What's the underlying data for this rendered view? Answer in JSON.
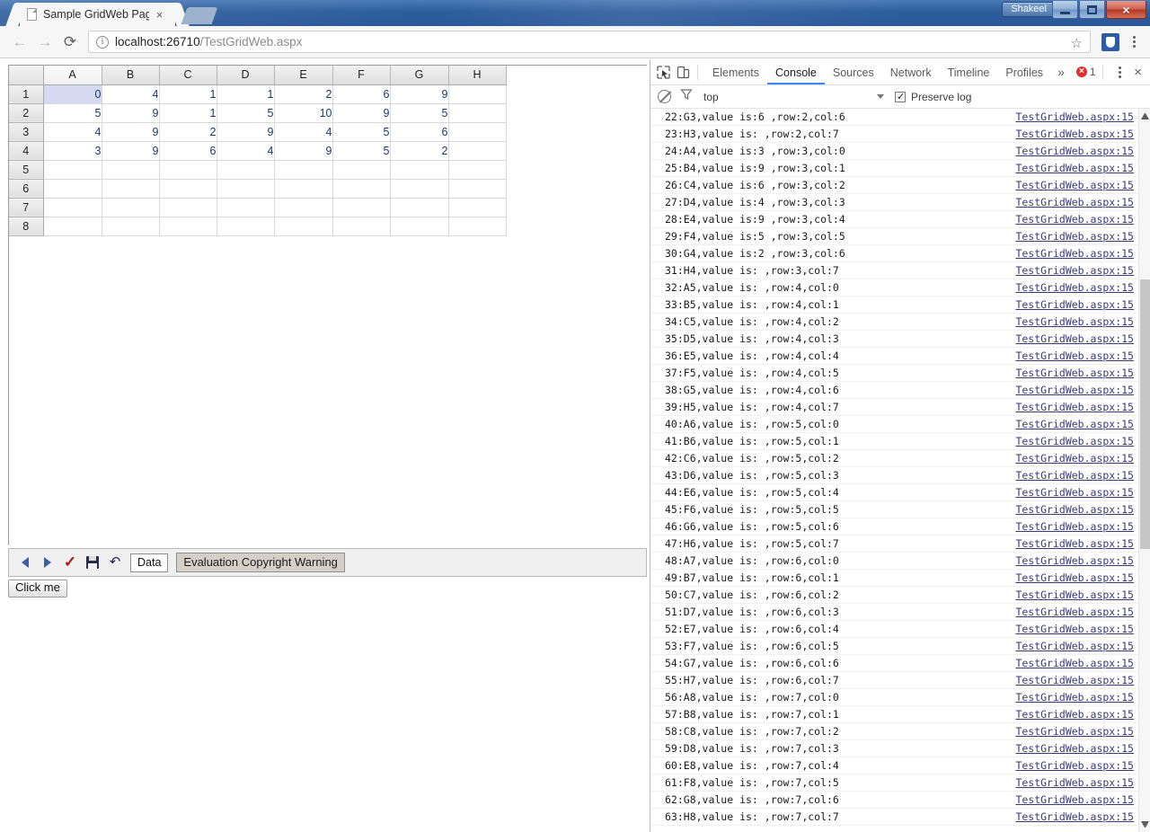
{
  "window": {
    "user_button_label": "Shakeel",
    "minimize_label": "–",
    "maximize_label": "",
    "close_label": "×"
  },
  "tabstrip": {
    "tab_title": "Sample GridWeb Page",
    "tab_close_label": "×",
    "new_tab_label": ""
  },
  "toolbar": {
    "back_label": "←",
    "forward_label": "→",
    "reload_label": "⟳",
    "info_label": "i",
    "url_host": "localhost:26710",
    "url_path": "/TestGridWeb.aspx",
    "star_label": "☆",
    "extension_name": "extension-icon",
    "menu_label": "menu"
  },
  "spreadsheet": {
    "columns": [
      "A",
      "B",
      "C",
      "D",
      "E",
      "F",
      "G",
      "H"
    ],
    "rows": [
      "1",
      "2",
      "3",
      "4",
      "5",
      "6",
      "7",
      "8"
    ],
    "selected_cell": "A1",
    "data": [
      [
        "0",
        "4",
        "1",
        "1",
        "2",
        "6",
        "9",
        ""
      ],
      [
        "5",
        "9",
        "1",
        "5",
        "10",
        "9",
        "5",
        ""
      ],
      [
        "4",
        "9",
        "2",
        "9",
        "4",
        "5",
        "6",
        ""
      ],
      [
        "3",
        "9",
        "6",
        "4",
        "9",
        "5",
        "2",
        ""
      ],
      [
        "",
        "",
        "",
        "",
        "",
        "",
        "",
        ""
      ],
      [
        "",
        "",
        "",
        "",
        "",
        "",
        "",
        ""
      ],
      [
        "",
        "",
        "",
        "",
        "",
        "",
        "",
        ""
      ],
      [
        "",
        "",
        "",
        "",
        "",
        "",
        "",
        ""
      ]
    ],
    "toolbar": {
      "prev_label": "",
      "next_label": "",
      "accept_label": "✓",
      "save_label": "save",
      "undo_label": "↶",
      "sheet_tab_label": "Data",
      "copyright_label": "Evaluation Copyright Warning"
    },
    "click_me_label": "Click me"
  },
  "devtools": {
    "inspect_icon": "inspect-element-icon",
    "device_icon": "device-toolbar-icon",
    "tabs": [
      {
        "label": "Elements",
        "active": false
      },
      {
        "label": "Console",
        "active": true
      },
      {
        "label": "Sources",
        "active": false
      },
      {
        "label": "Network",
        "active": false
      },
      {
        "label": "Timeline",
        "active": false
      },
      {
        "label": "Profiles",
        "active": false
      }
    ],
    "more_label": "»",
    "error_count": "1",
    "settings_label": "more-options",
    "close_label": "×",
    "filter": {
      "clear_label": "clear-console",
      "funnel_label": "filter",
      "context": "top",
      "preserve_log_label": "Preserve log",
      "preserve_log_checked": true
    },
    "console_log": [
      {
        "msg": "22:G3,value is:6 ,row:2,col:6",
        "src": "TestGridWeb.aspx:15"
      },
      {
        "msg": "23:H3,value is: ,row:2,col:7",
        "src": "TestGridWeb.aspx:15"
      },
      {
        "msg": "24:A4,value is:3 ,row:3,col:0",
        "src": "TestGridWeb.aspx:15"
      },
      {
        "msg": "25:B4,value is:9 ,row:3,col:1",
        "src": "TestGridWeb.aspx:15"
      },
      {
        "msg": "26:C4,value is:6 ,row:3,col:2",
        "src": "TestGridWeb.aspx:15"
      },
      {
        "msg": "27:D4,value is:4 ,row:3,col:3",
        "src": "TestGridWeb.aspx:15"
      },
      {
        "msg": "28:E4,value is:9 ,row:3,col:4",
        "src": "TestGridWeb.aspx:15"
      },
      {
        "msg": "29:F4,value is:5 ,row:3,col:5",
        "src": "TestGridWeb.aspx:15"
      },
      {
        "msg": "30:G4,value is:2 ,row:3,col:6",
        "src": "TestGridWeb.aspx:15"
      },
      {
        "msg": "31:H4,value is: ,row:3,col:7",
        "src": "TestGridWeb.aspx:15"
      },
      {
        "msg": "32:A5,value is: ,row:4,col:0",
        "src": "TestGridWeb.aspx:15"
      },
      {
        "msg": "33:B5,value is: ,row:4,col:1",
        "src": "TestGridWeb.aspx:15"
      },
      {
        "msg": "34:C5,value is: ,row:4,col:2",
        "src": "TestGridWeb.aspx:15"
      },
      {
        "msg": "35:D5,value is: ,row:4,col:3",
        "src": "TestGridWeb.aspx:15"
      },
      {
        "msg": "36:E5,value is: ,row:4,col:4",
        "src": "TestGridWeb.aspx:15"
      },
      {
        "msg": "37:F5,value is: ,row:4,col:5",
        "src": "TestGridWeb.aspx:15"
      },
      {
        "msg": "38:G5,value is: ,row:4,col:6",
        "src": "TestGridWeb.aspx:15"
      },
      {
        "msg": "39:H5,value is: ,row:4,col:7",
        "src": "TestGridWeb.aspx:15"
      },
      {
        "msg": "40:A6,value is: ,row:5,col:0",
        "src": "TestGridWeb.aspx:15"
      },
      {
        "msg": "41:B6,value is: ,row:5,col:1",
        "src": "TestGridWeb.aspx:15"
      },
      {
        "msg": "42:C6,value is: ,row:5,col:2",
        "src": "TestGridWeb.aspx:15"
      },
      {
        "msg": "43:D6,value is: ,row:5,col:3",
        "src": "TestGridWeb.aspx:15"
      },
      {
        "msg": "44:E6,value is: ,row:5,col:4",
        "src": "TestGridWeb.aspx:15"
      },
      {
        "msg": "45:F6,value is: ,row:5,col:5",
        "src": "TestGridWeb.aspx:15"
      },
      {
        "msg": "46:G6,value is: ,row:5,col:6",
        "src": "TestGridWeb.aspx:15"
      },
      {
        "msg": "47:H6,value is: ,row:5,col:7",
        "src": "TestGridWeb.aspx:15"
      },
      {
        "msg": "48:A7,value is: ,row:6,col:0",
        "src": "TestGridWeb.aspx:15"
      },
      {
        "msg": "49:B7,value is: ,row:6,col:1",
        "src": "TestGridWeb.aspx:15"
      },
      {
        "msg": "50:C7,value is: ,row:6,col:2",
        "src": "TestGridWeb.aspx:15"
      },
      {
        "msg": "51:D7,value is: ,row:6,col:3",
        "src": "TestGridWeb.aspx:15"
      },
      {
        "msg": "52:E7,value is: ,row:6,col:4",
        "src": "TestGridWeb.aspx:15"
      },
      {
        "msg": "53:F7,value is: ,row:6,col:5",
        "src": "TestGridWeb.aspx:15"
      },
      {
        "msg": "54:G7,value is: ,row:6,col:6",
        "src": "TestGridWeb.aspx:15"
      },
      {
        "msg": "55:H7,value is: ,row:6,col:7",
        "src": "TestGridWeb.aspx:15"
      },
      {
        "msg": "56:A8,value is: ,row:7,col:0",
        "src": "TestGridWeb.aspx:15"
      },
      {
        "msg": "57:B8,value is: ,row:7,col:1",
        "src": "TestGridWeb.aspx:15"
      },
      {
        "msg": "58:C8,value is: ,row:7,col:2",
        "src": "TestGridWeb.aspx:15"
      },
      {
        "msg": "59:D8,value is: ,row:7,col:3",
        "src": "TestGridWeb.aspx:15"
      },
      {
        "msg": "60:E8,value is: ,row:7,col:4",
        "src": "TestGridWeb.aspx:15"
      },
      {
        "msg": "61:F8,value is: ,row:7,col:5",
        "src": "TestGridWeb.aspx:15"
      },
      {
        "msg": "62:G8,value is: ,row:7,col:6",
        "src": "TestGridWeb.aspx:15"
      },
      {
        "msg": "63:H8,value is: ,row:7,col:7",
        "src": "TestGridWeb.aspx:15"
      }
    ]
  },
  "colors": {
    "accent": "#4285f4",
    "titlebar": "#2c5d9b",
    "selection": "#d6d9f2",
    "error": "#e03030",
    "cell_text": "#1b3a6b"
  }
}
